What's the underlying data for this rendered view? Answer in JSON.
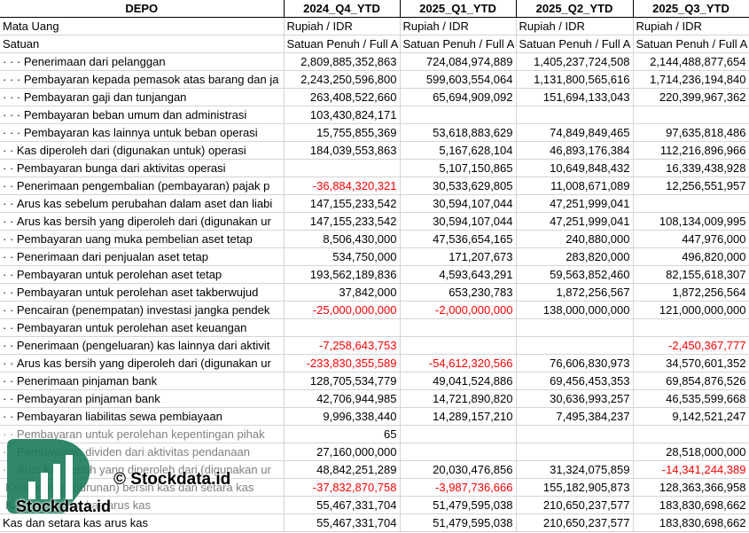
{
  "header": {
    "columns": [
      "DEPO",
      "2024_Q4_YTD",
      "2025_Q1_YTD",
      "2025_Q2_YTD",
      "2025_Q3_YTD"
    ]
  },
  "meta_rows": [
    {
      "label": "Mata Uang",
      "values": [
        "Rupiah / IDR",
        "Rupiah / IDR",
        "Rupiah / IDR",
        "Rupiah / IDR"
      ]
    },
    {
      "label": "Satuan",
      "values": [
        "Satuan Penuh / Full A",
        "Satuan Penuh / Full A",
        "Satuan Penuh / Full A",
        "Satuan Penuh / Full A"
      ]
    }
  ],
  "rows": [
    {
      "label": "Penerimaan dari pelanggan",
      "level": 3,
      "values": [
        "2,809,885,352,863",
        "724,084,974,889",
        "1,405,237,724,508",
        "2,144,488,877,654"
      ]
    },
    {
      "label": "Pembayaran kepada pemasok atas barang dan ja",
      "level": 3,
      "values": [
        "2,243,250,596,800",
        "599,603,554,064",
        "1,131,800,565,616",
        "1,714,236,194,840"
      ]
    },
    {
      "label": "Pembayaran gaji dan tunjangan",
      "level": 3,
      "values": [
        "263,408,522,660",
        "65,694,909,092",
        "151,694,133,043",
        "220,399,967,362"
      ]
    },
    {
      "label": "Pembayaran beban umum dan administrasi",
      "level": 3,
      "values": [
        "103,430,824,171",
        "",
        "",
        ""
      ]
    },
    {
      "label": "Pembayaran kas lainnya untuk beban operasi",
      "level": 3,
      "values": [
        "15,755,855,369",
        "53,618,883,629",
        "74,849,849,465",
        "97,635,818,486"
      ]
    },
    {
      "label": "Kas diperoleh dari (digunakan untuk) operasi",
      "level": 2,
      "values": [
        "184,039,553,863",
        "5,167,628,104",
        "46,893,176,384",
        "112,216,896,966"
      ]
    },
    {
      "label": "Pembayaran bunga dari aktivitas operasi",
      "level": 2,
      "values": [
        "",
        "5,107,150,865",
        "10,649,848,432",
        "16,339,438,928"
      ]
    },
    {
      "label": "Penerimaan pengembalian (pembayaran) pajak p",
      "level": 2,
      "values": [
        "-36,884,320,321",
        "30,533,629,805",
        "11,008,671,089",
        "12,256,551,957"
      ]
    },
    {
      "label": "Arus kas sebelum perubahan dalam aset dan liabi",
      "level": 2,
      "values": [
        "147,155,233,542",
        "30,594,107,044",
        "47,251,999,041",
        ""
      ]
    },
    {
      "label": "Arus kas bersih yang diperoleh dari (digunakan ur",
      "level": 2,
      "values": [
        "147,155,233,542",
        "30,594,107,044",
        "47,251,999,041",
        "108,134,009,995"
      ]
    },
    {
      "label": "Pembayaran uang muka pembelian aset tetap",
      "level": 2,
      "values": [
        "8,506,430,000",
        "47,536,654,165",
        "240,880,000",
        "447,976,000"
      ]
    },
    {
      "label": "Penerimaan dari penjualan aset tetap",
      "level": 2,
      "values": [
        "534,750,000",
        "171,207,673",
        "283,820,000",
        "496,820,000"
      ]
    },
    {
      "label": "Pembayaran untuk perolehan aset tetap",
      "level": 2,
      "values": [
        "193,562,189,836",
        "4,593,643,291",
        "59,563,852,460",
        "82,155,618,307"
      ]
    },
    {
      "label": "Pembayaran untuk perolehan aset takberwujud",
      "level": 2,
      "values": [
        "37,842,000",
        "653,230,783",
        "1,872,256,567",
        "1,872,256,564"
      ]
    },
    {
      "label": "Pencairan (penempatan) investasi jangka pendek",
      "level": 2,
      "values": [
        "-25,000,000,000",
        "-2,000,000,000",
        "138,000,000,000",
        "121,000,000,000"
      ]
    },
    {
      "label": "Pembayaran untuk perolehan aset keuangan",
      "level": 2,
      "values": [
        "",
        "",
        "",
        ""
      ]
    },
    {
      "label": "Penerimaan (pengeluaran) kas lainnya dari aktivit",
      "level": 2,
      "values": [
        "-7,258,643,753",
        "",
        "",
        "-2,450,367,777"
      ]
    },
    {
      "label": "Arus kas bersih yang diperoleh dari (digunakan ur",
      "level": 2,
      "values": [
        "-233,830,355,589",
        "-54,612,320,566",
        "76,606,830,973",
        "34,570,601,352"
      ]
    },
    {
      "label": "Penerimaan pinjaman bank",
      "level": 2,
      "values": [
        "128,705,534,779",
        "49,041,524,886",
        "69,456,453,353",
        "69,854,876,526"
      ]
    },
    {
      "label": "Pembayaran pinjaman bank",
      "level": 2,
      "values": [
        "42,706,944,985",
        "14,721,890,820",
        "30,636,993,257",
        "46,535,599,668"
      ]
    },
    {
      "label": "Pembayaran liabilitas sewa pembiayaan",
      "level": 2,
      "values": [
        "9,996,338,440",
        "14,289,157,210",
        "7,495,384,237",
        "9,142,521,247"
      ]
    },
    {
      "label": "Pembayaran untuk perolehan kepentingan pihak",
      "level": 2,
      "faded": true,
      "values": [
        "65",
        "",
        "",
        ""
      ]
    },
    {
      "label": "Pembayaran dividen dari aktivitas pendanaan",
      "level": 2,
      "faded": true,
      "values": [
        "27,160,000,000",
        "",
        "",
        "28,518,000,000"
      ]
    },
    {
      "label": "Arus kas bersih yang diperoleh dari (digunakan ur",
      "level": 2,
      "faded": true,
      "values": [
        "48,842,251,289",
        "20,030,476,856",
        "31,324,075,859",
        "-14,341,244,389"
      ]
    },
    {
      "label": "Kenaikan (penurunan) bersih kas dan setara kas",
      "level": 1,
      "faded": true,
      "values": [
        "-37,832,870,758",
        "-3,987,736,666",
        "155,182,905,873",
        "128,363,366,958"
      ]
    },
    {
      "label": "Kas dan setara kas arus kas",
      "level": 1,
      "faded": true,
      "values": [
        "55,467,331,704",
        "51,479,595,038",
        "210,650,237,577",
        "183,830,698,662"
      ]
    },
    {
      "label": "Kas dan setara kas arus kas",
      "level": 0,
      "values": [
        "55,467,331,704",
        "51,479,595,038",
        "210,650,237,577",
        "183,830,698,662"
      ]
    }
  ],
  "watermark": {
    "text_main": "© Stockdata.id",
    "text_logo": "Stockdata.id",
    "icon": "bar-chart-logo-icon",
    "color": "#1a7a5a"
  },
  "colors": {
    "negative": "#ff0000",
    "border": "#d4d4d4",
    "header_border": "#000000"
  }
}
